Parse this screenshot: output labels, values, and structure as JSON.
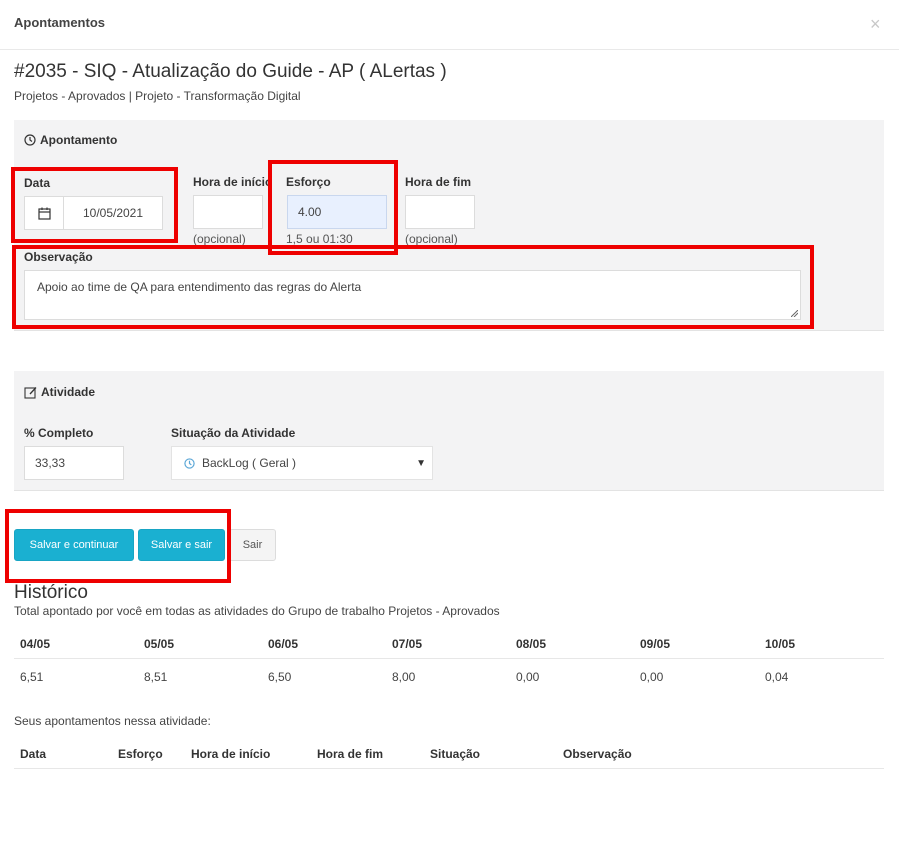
{
  "modal": {
    "title": "Apontamentos",
    "close_icon": "×"
  },
  "task": {
    "title": "#2035 - SIQ - Atualização do Guide - AP ( ALertas )",
    "subtitle": "Projetos - Aprovados | Projeto - Transformação Digital"
  },
  "apontamento": {
    "section_title": "Apontamento",
    "data_label": "Data",
    "data_value": "10/05/2021",
    "hora_inicio_label": "Hora de início",
    "hora_inicio_value": "",
    "hora_inicio_hint": "(opcional)",
    "esforco_label": "Esforço",
    "esforco_value": "4.00",
    "esforco_hint": "1,5 ou 01:30",
    "hora_fim_label": "Hora de fim",
    "hora_fim_value": "",
    "hora_fim_hint": "(opcional)",
    "observacao_label": "Observação",
    "observacao_value": "Apoio ao time de QA para entendimento das regras do Alerta"
  },
  "atividade": {
    "section_title": "Atividade",
    "completo_label": "% Completo",
    "completo_value": "33,33",
    "situacao_label": "Situação da Atividade",
    "situacao_value": "BackLog ( Geral )"
  },
  "buttons": {
    "save_continue": "Salvar e continuar",
    "save_exit": "Salvar e sair",
    "exit": "Sair"
  },
  "historico": {
    "title": "Histórico",
    "subtitle": "Total apontado por você em todas as atividades do Grupo de trabalho Projetos - Aprovados",
    "days": [
      "04/05",
      "05/05",
      "06/05",
      "07/05",
      "08/05",
      "09/05",
      "10/05"
    ],
    "totals": [
      "6,51",
      "8,51",
      "6,50",
      "8,00",
      "0,00",
      "0,00",
      "0,04"
    ],
    "entries_caption": "Seus apontamentos nessa atividade:",
    "entries_columns": [
      "Data",
      "Esforço",
      "Hora de início",
      "Hora de fim",
      "Situação",
      "Observação"
    ]
  },
  "colors": {
    "primary_button": "#1ab0d1",
    "highlight_box": "#ee0000",
    "panel_bg": "#f3f3f4",
    "autofill_bg": "#e8f0fe"
  }
}
